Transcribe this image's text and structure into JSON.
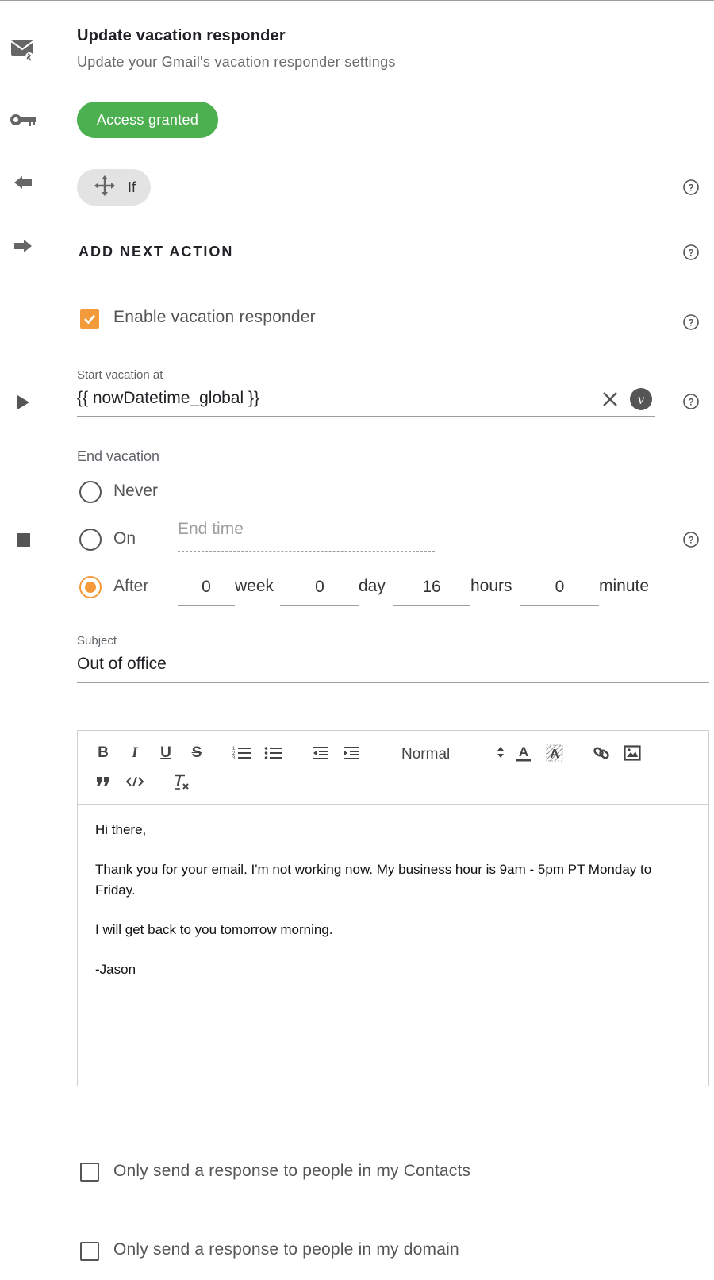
{
  "header": {
    "title": "Update vacation responder",
    "subtitle": "Update your Gmail's vacation responder settings"
  },
  "access": {
    "label": "Access granted",
    "color": "#4caf50"
  },
  "condition": {
    "label": "If"
  },
  "next_action": {
    "label": "ADD NEXT ACTION"
  },
  "enable": {
    "label": "Enable vacation responder",
    "checked": true
  },
  "start": {
    "label": "Start vacation at",
    "value": "{{ nowDatetime_global }}",
    "variable_badge": "v"
  },
  "end": {
    "label": "End vacation",
    "never_label": "Never",
    "on_label": "On",
    "end_time_placeholder": "End time",
    "after_label": "After",
    "selected": "after",
    "week_value": "0",
    "week_unit": "week",
    "day_value": "0",
    "day_unit": "day",
    "hours_value": "16",
    "hours_unit": "hours",
    "minute_value": "0",
    "minute_unit": "minute"
  },
  "subject": {
    "label": "Subject",
    "value": "Out of office"
  },
  "editor": {
    "format_select": "Normal",
    "toolbar_icons": [
      "bold-icon",
      "italic-icon",
      "underline-icon",
      "strikethrough-icon",
      "ordered-list-icon",
      "bullet-list-icon",
      "outdent-icon",
      "indent-icon",
      "text-color-icon",
      "background-color-icon",
      "link-icon",
      "image-icon",
      "blockquote-icon",
      "code-icon",
      "clear-format-icon"
    ],
    "body": {
      "line1": "Hi there,",
      "line2": "Thank you for your email. I'm not working now. My business hour is 9am - 5pm PT Monday to Friday.",
      "line3": "I will get back to you tomorrow morning.",
      "line4": "-Jason"
    }
  },
  "options": {
    "contacts_only": {
      "label": "Only send a response to people in my Contacts",
      "checked": false
    },
    "domain_only": {
      "label": "Only send a response to people in my domain",
      "checked": false
    }
  },
  "colors": {
    "accent": "#f39a3a",
    "success": "#4caf50"
  }
}
